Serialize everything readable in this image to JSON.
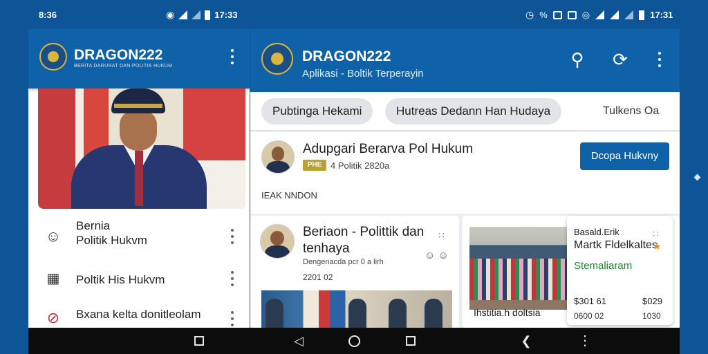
{
  "status_bar": {
    "left_time": "8:36",
    "left_clock": "17:33",
    "right_clock": "17:31"
  },
  "left_panel": {
    "app_title": "DRAGON222",
    "app_subtitle": "BERITA DARURAT DAN POLITIK HUKUM",
    "menu_items": [
      {
        "label": "Bernia\nPolitik Hukvm",
        "icon": "piggy-icon"
      },
      {
        "label": "Poltik His Hukvm",
        "icon": "list-icon"
      },
      {
        "label": "Bxana kelta donitleolam",
        "icon": "no-symbol-icon"
      }
    ]
  },
  "main_panel": {
    "app_title": "DRAGON222",
    "app_subtitle": "Aplikasi - Boltik Terperayin",
    "chips": [
      "Pubtinga Hekami",
      "Hutreas Dedann Han Hudaya"
    ],
    "chip_plain": "Tulkens Oa",
    "post": {
      "title": "Adupgari Berarva Pol Hukum",
      "badge": "PHE",
      "meta": "4 Politik 2820a",
      "footer": "IEAK NNDON",
      "button": "Dcopa Hukvny"
    },
    "card_a": {
      "title": "Beriaon - Polittik dan tenhaya",
      "meta": "Dengenacda pcr 0 a lirh",
      "date": "2201 02"
    },
    "card_b": {
      "caption": "Ihstitia.h doltsia",
      "line1": "Basald.Erik",
      "line2": "Martk Fldelkaltes",
      "green": "Stemaliaram",
      "v1": "$301 61",
      "v2": "$029",
      "v3": "0600 02",
      "v4": "1030"
    }
  },
  "colors": {
    "header_blue": "#0f61a8",
    "background_blue": "#0d5596",
    "accent_green": "#168a2c"
  }
}
